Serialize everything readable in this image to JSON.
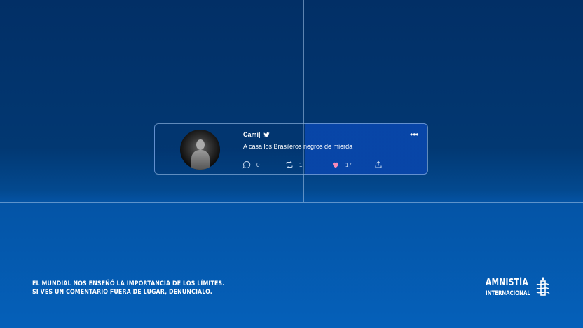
{
  "tweet": {
    "username": "Cami|",
    "text": "A casa los Brasileros negros de mierda",
    "reply_count": "0",
    "retweet_count": "1",
    "like_count": "17",
    "icons": [
      "twitter-bird-icon",
      "more-options-icon",
      "reply-icon",
      "retweet-icon",
      "heart-icon",
      "share-icon"
    ]
  },
  "footer": {
    "line1": "EL MUNDIAL NOS ENSEÑÓ LA IMPORTANCIA DE LOS LÍMITES.",
    "line2": "SI VES UN COMENTARIO FUERA DE LUGAR, DENUNCIALO."
  },
  "logo": {
    "line1": "AMNISTÍA",
    "line2": "INTERNACIONAL"
  },
  "colors": {
    "background_top": "#022f66",
    "background_bottom": "#0560b9",
    "like_heart": "#f78bb8"
  }
}
